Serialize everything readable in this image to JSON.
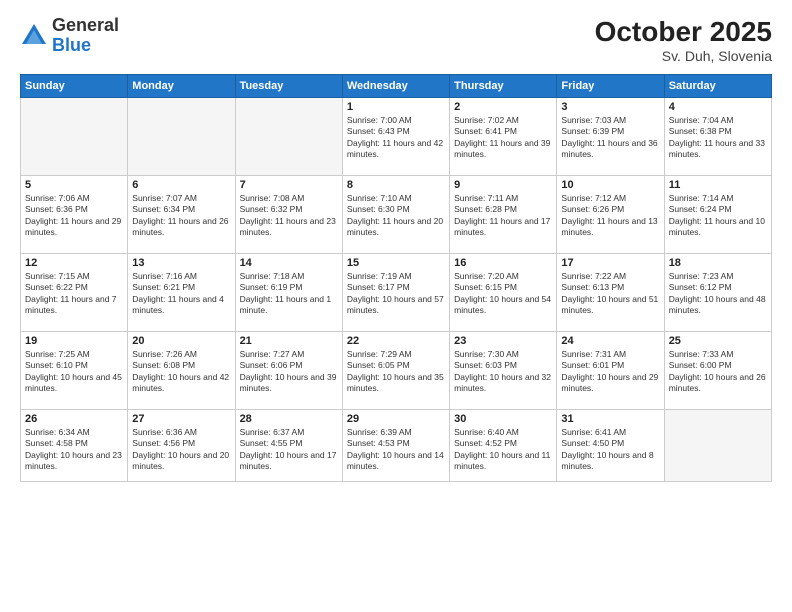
{
  "header": {
    "logo_general": "General",
    "logo_blue": "Blue",
    "month_year": "October 2025",
    "location": "Sv. Duh, Slovenia"
  },
  "days_of_week": [
    "Sunday",
    "Monday",
    "Tuesday",
    "Wednesday",
    "Thursday",
    "Friday",
    "Saturday"
  ],
  "weeks": [
    [
      {
        "day": "",
        "empty": true
      },
      {
        "day": "",
        "empty": true
      },
      {
        "day": "",
        "empty": true
      },
      {
        "day": "1",
        "sunrise": "7:00 AM",
        "sunset": "6:43 PM",
        "daylight": "11 hours and 42 minutes."
      },
      {
        "day": "2",
        "sunrise": "7:02 AM",
        "sunset": "6:41 PM",
        "daylight": "11 hours and 39 minutes."
      },
      {
        "day": "3",
        "sunrise": "7:03 AM",
        "sunset": "6:39 PM",
        "daylight": "11 hours and 36 minutes."
      },
      {
        "day": "4",
        "sunrise": "7:04 AM",
        "sunset": "6:38 PM",
        "daylight": "11 hours and 33 minutes."
      }
    ],
    [
      {
        "day": "5",
        "sunrise": "7:06 AM",
        "sunset": "6:36 PM",
        "daylight": "11 hours and 29 minutes."
      },
      {
        "day": "6",
        "sunrise": "7:07 AM",
        "sunset": "6:34 PM",
        "daylight": "11 hours and 26 minutes."
      },
      {
        "day": "7",
        "sunrise": "7:08 AM",
        "sunset": "6:32 PM",
        "daylight": "11 hours and 23 minutes."
      },
      {
        "day": "8",
        "sunrise": "7:10 AM",
        "sunset": "6:30 PM",
        "daylight": "11 hours and 20 minutes."
      },
      {
        "day": "9",
        "sunrise": "7:11 AM",
        "sunset": "6:28 PM",
        "daylight": "11 hours and 17 minutes."
      },
      {
        "day": "10",
        "sunrise": "7:12 AM",
        "sunset": "6:26 PM",
        "daylight": "11 hours and 13 minutes."
      },
      {
        "day": "11",
        "sunrise": "7:14 AM",
        "sunset": "6:24 PM",
        "daylight": "11 hours and 10 minutes."
      }
    ],
    [
      {
        "day": "12",
        "sunrise": "7:15 AM",
        "sunset": "6:22 PM",
        "daylight": "11 hours and 7 minutes."
      },
      {
        "day": "13",
        "sunrise": "7:16 AM",
        "sunset": "6:21 PM",
        "daylight": "11 hours and 4 minutes."
      },
      {
        "day": "14",
        "sunrise": "7:18 AM",
        "sunset": "6:19 PM",
        "daylight": "11 hours and 1 minute."
      },
      {
        "day": "15",
        "sunrise": "7:19 AM",
        "sunset": "6:17 PM",
        "daylight": "10 hours and 57 minutes."
      },
      {
        "day": "16",
        "sunrise": "7:20 AM",
        "sunset": "6:15 PM",
        "daylight": "10 hours and 54 minutes."
      },
      {
        "day": "17",
        "sunrise": "7:22 AM",
        "sunset": "6:13 PM",
        "daylight": "10 hours and 51 minutes."
      },
      {
        "day": "18",
        "sunrise": "7:23 AM",
        "sunset": "6:12 PM",
        "daylight": "10 hours and 48 minutes."
      }
    ],
    [
      {
        "day": "19",
        "sunrise": "7:25 AM",
        "sunset": "6:10 PM",
        "daylight": "10 hours and 45 minutes."
      },
      {
        "day": "20",
        "sunrise": "7:26 AM",
        "sunset": "6:08 PM",
        "daylight": "10 hours and 42 minutes."
      },
      {
        "day": "21",
        "sunrise": "7:27 AM",
        "sunset": "6:06 PM",
        "daylight": "10 hours and 39 minutes."
      },
      {
        "day": "22",
        "sunrise": "7:29 AM",
        "sunset": "6:05 PM",
        "daylight": "10 hours and 35 minutes."
      },
      {
        "day": "23",
        "sunrise": "7:30 AM",
        "sunset": "6:03 PM",
        "daylight": "10 hours and 32 minutes."
      },
      {
        "day": "24",
        "sunrise": "7:31 AM",
        "sunset": "6:01 PM",
        "daylight": "10 hours and 29 minutes."
      },
      {
        "day": "25",
        "sunrise": "7:33 AM",
        "sunset": "6:00 PM",
        "daylight": "10 hours and 26 minutes."
      }
    ],
    [
      {
        "day": "26",
        "sunrise": "6:34 AM",
        "sunset": "4:58 PM",
        "daylight": "10 hours and 23 minutes."
      },
      {
        "day": "27",
        "sunrise": "6:36 AM",
        "sunset": "4:56 PM",
        "daylight": "10 hours and 20 minutes."
      },
      {
        "day": "28",
        "sunrise": "6:37 AM",
        "sunset": "4:55 PM",
        "daylight": "10 hours and 17 minutes."
      },
      {
        "day": "29",
        "sunrise": "6:39 AM",
        "sunset": "4:53 PM",
        "daylight": "10 hours and 14 minutes."
      },
      {
        "day": "30",
        "sunrise": "6:40 AM",
        "sunset": "4:52 PM",
        "daylight": "10 hours and 11 minutes."
      },
      {
        "day": "31",
        "sunrise": "6:41 AM",
        "sunset": "4:50 PM",
        "daylight": "10 hours and 8 minutes."
      },
      {
        "day": "",
        "empty": true
      }
    ]
  ]
}
